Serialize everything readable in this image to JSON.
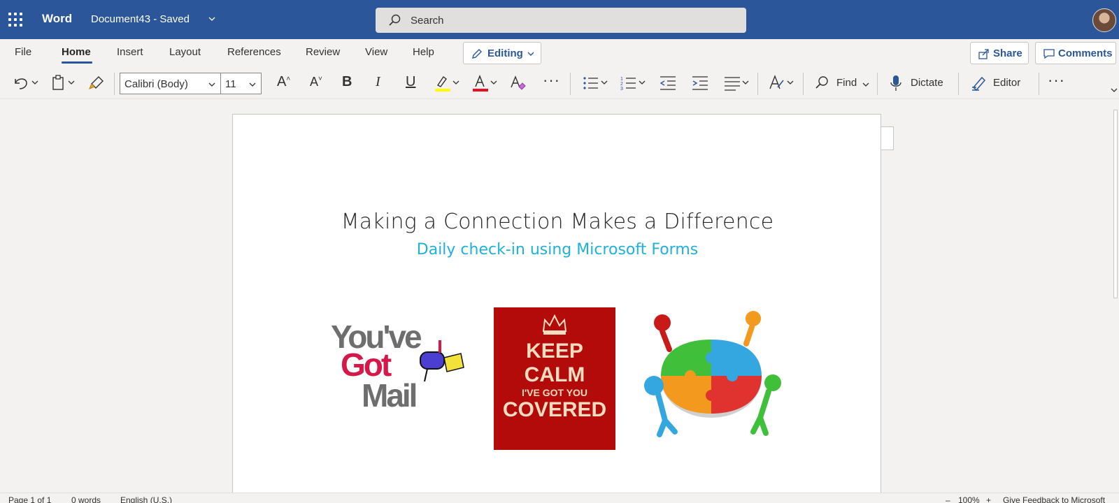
{
  "titlebar": {
    "app_name": "Word",
    "doc_name": "Document43  -  Saved",
    "search_placeholder": "Search",
    "bg_color": "#2b579a"
  },
  "ribbon_tabs": {
    "file": "File",
    "home": "Home",
    "insert": "Insert",
    "layout": "Layout",
    "references": "References",
    "review": "Review",
    "view": "View",
    "help": "Help",
    "editing": "Editing",
    "share": "Share",
    "comments": "Comments",
    "active": "Home"
  },
  "toolbar": {
    "font_name": "Calibri (Body)",
    "font_size": "11",
    "grow_font": "A",
    "shrink_font": "A",
    "bold": "B",
    "italic": "I",
    "underline": "U",
    "font_color_letter": "A",
    "more": "···",
    "find": "Find",
    "dictate": "Dictate",
    "editor": "Editor",
    "highlight_color": "#ffff00",
    "font_color": "#e81123",
    "icons": [
      "undo-icon",
      "paste-icon",
      "format-painter-icon",
      "clear-formatting-icon",
      "bullets-icon",
      "numbering-icon",
      "decrease-indent-icon",
      "increase-indent-icon",
      "align-icon",
      "styles-icon",
      "search-icon",
      "microphone-icon",
      "editor-pen-icon"
    ]
  },
  "document": {
    "title": "Making a Connection Makes a Difference",
    "subtitle": "Daily check-in using Microsoft Forms",
    "subtitle_color": "#1fb1d9",
    "images": {
      "mail": {
        "line1": "You've",
        "line2": "Got",
        "line3": "Mail"
      },
      "keep_calm": {
        "line1": "KEEP",
        "line2": "CALM",
        "line3": "I'VE GOT YOU",
        "line4": "COVERED",
        "bg_color": "#b30a0a"
      }
    }
  },
  "statusbar": {
    "page": "Page 1 of 1",
    "words": "0 words",
    "language": "English (U.S.)",
    "zoom": "100%",
    "feedback": "Give Feedback to Microsoft"
  }
}
